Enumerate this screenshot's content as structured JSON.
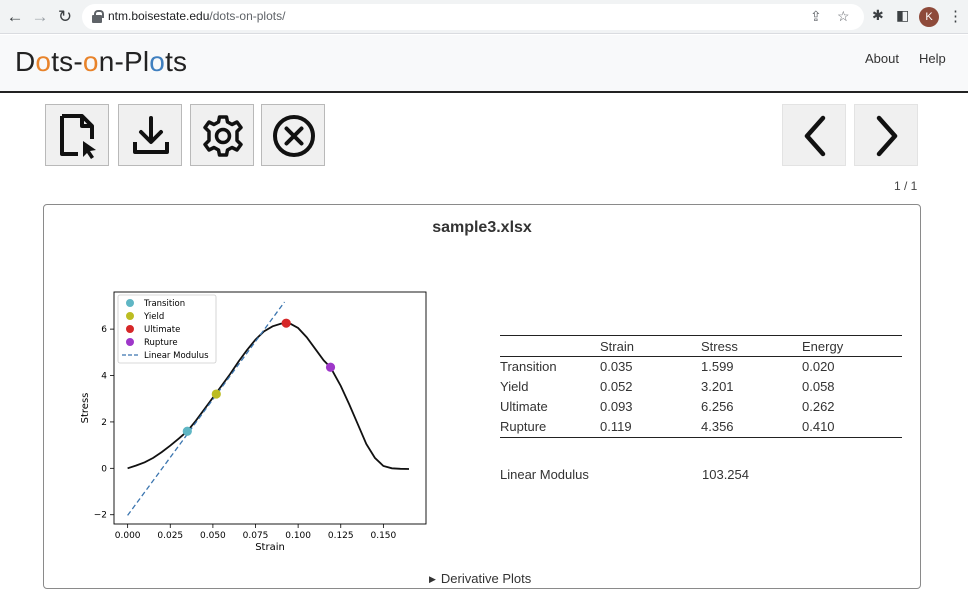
{
  "browser": {
    "url_host": "ntm.boisestate.edu",
    "url_path": "/dots-on-plots/",
    "profile_initial": "K"
  },
  "site": {
    "logo": {
      "p1": "D",
      "o1": "o",
      "p2": "ts-",
      "o2": "o",
      "p3": "n-Pl",
      "o3": "o",
      "p4": "ts"
    },
    "nav": {
      "about": "About",
      "help": "Help"
    }
  },
  "toolbar": {
    "icons": [
      "open-file-icon",
      "download-icon",
      "settings-gear-icon",
      "close-circle-icon"
    ],
    "prev_icon": "chevron-left-icon",
    "next_icon": "chevron-right-icon",
    "page_counter": "1 / 1"
  },
  "card": {
    "title": "sample3.xlsx",
    "details_label": "Derivative Plots"
  },
  "results": {
    "headers": [
      "",
      "Strain",
      "Stress",
      "Energy"
    ],
    "rows": [
      {
        "label": "Transition",
        "strain": "0.035",
        "stress": "1.599",
        "energy": "0.020"
      },
      {
        "label": "Yield",
        "strain": "0.052",
        "stress": "3.201",
        "energy": "0.058"
      },
      {
        "label": "Ultimate",
        "strain": "0.093",
        "stress": "6.256",
        "energy": "0.262"
      },
      {
        "label": "Rupture",
        "strain": "0.119",
        "stress": "4.356",
        "energy": "0.410"
      }
    ],
    "linear_modulus_label": "Linear Modulus",
    "linear_modulus_value": "103.254"
  },
  "chart_data": {
    "type": "line",
    "title": "",
    "xlabel": "Strain",
    "ylabel": "Stress",
    "xlim": [
      -0.008,
      0.175
    ],
    "ylim": [
      -2.4,
      7.6
    ],
    "xticks": [
      0.0,
      0.025,
      0.05,
      0.075,
      0.1,
      0.125,
      0.15
    ],
    "xtick_labels": [
      "0.000",
      "0.025",
      "0.050",
      "0.075",
      "0.100",
      "0.125",
      "0.150"
    ],
    "yticks": [
      -2,
      0,
      2,
      4,
      6
    ],
    "ytick_labels": [
      "−2",
      "0",
      "2",
      "4",
      "6"
    ],
    "grid": false,
    "legend": "top-left",
    "series": [
      {
        "name": "",
        "kind": "line",
        "color": "#111111",
        "x": [
          0.0,
          0.005,
          0.01,
          0.015,
          0.02,
          0.025,
          0.03,
          0.035,
          0.04,
          0.045,
          0.05,
          0.055,
          0.06,
          0.065,
          0.07,
          0.075,
          0.08,
          0.085,
          0.09,
          0.093,
          0.095,
          0.1,
          0.105,
          0.11,
          0.115,
          0.119,
          0.125,
          0.13,
          0.135,
          0.14,
          0.145,
          0.15,
          0.155,
          0.16,
          0.165
        ],
        "y": [
          0.0,
          0.12,
          0.26,
          0.45,
          0.7,
          0.98,
          1.28,
          1.599,
          2.05,
          2.55,
          3.05,
          3.55,
          4.05,
          4.6,
          5.1,
          5.55,
          5.9,
          6.12,
          6.24,
          6.256,
          6.25,
          6.05,
          5.65,
          5.15,
          4.65,
          4.356,
          3.55,
          2.75,
          1.9,
          1.05,
          0.45,
          0.1,
          0.0,
          -0.02,
          -0.03
        ]
      },
      {
        "name": "Linear Modulus",
        "kind": "dashed",
        "color": "#3b75af",
        "x": [
          0.0,
          0.092
        ],
        "y": [
          -2.03,
          7.17
        ]
      },
      {
        "name": "Transition",
        "kind": "point",
        "color": "#5fb6c4",
        "x": [
          0.035
        ],
        "y": [
          1.599
        ]
      },
      {
        "name": "Yield",
        "kind": "point",
        "color": "#bcbd22",
        "x": [
          0.052
        ],
        "y": [
          3.201
        ]
      },
      {
        "name": "Ultimate",
        "kind": "point",
        "color": "#d62728",
        "x": [
          0.093
        ],
        "y": [
          6.256
        ]
      },
      {
        "name": "Rupture",
        "kind": "point",
        "color": "#9e37c9",
        "x": [
          0.119
        ],
        "y": [
          4.356
        ]
      }
    ]
  }
}
